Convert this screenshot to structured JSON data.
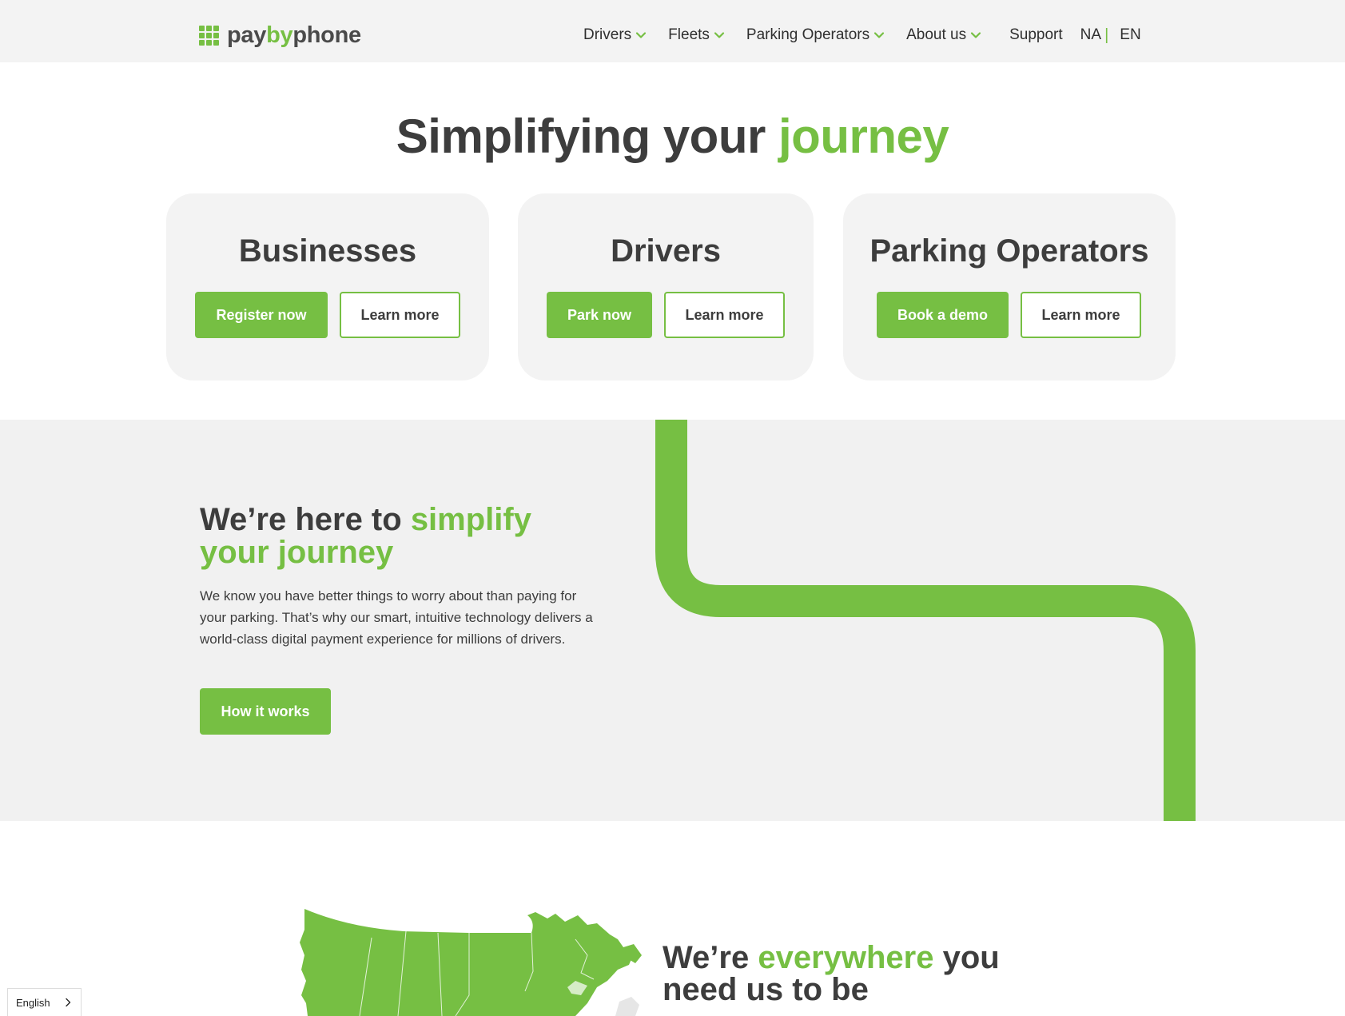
{
  "brand": {
    "logo_pay": "pay",
    "logo_by": "by",
    "logo_phone": "phone",
    "accent": "#76bf43",
    "text_dark": "#3d3d3d"
  },
  "nav": {
    "items": [
      {
        "label": "Drivers",
        "icon": "chevron-down-icon"
      },
      {
        "label": "Fleets",
        "icon": "chevron-down-icon"
      },
      {
        "label": "Parking Operators",
        "icon": "chevron-down-icon"
      },
      {
        "label": "About us",
        "icon": "chevron-down-icon"
      }
    ],
    "support": "Support",
    "region": "NA",
    "separator": "|",
    "language": "EN"
  },
  "hero": {
    "title_main": "Simplifying your",
    "title_highlight": "journey"
  },
  "cards": [
    {
      "title": "Businesses",
      "primary": "Register now",
      "secondary": "Learn more"
    },
    {
      "title": "Drivers",
      "primary": "Park now",
      "secondary": "Learn more"
    },
    {
      "title": "Parking Operators",
      "primary": "Book a demo",
      "secondary": "Learn more"
    }
  ],
  "simplify": {
    "title_main": "We’re here to",
    "title_highlight": "simplify your journey",
    "body": "We know you have better things to worry about than paying for your parking. That’s why our smart, intuitive technology delivers a world-class digital payment experience for millions of drivers.",
    "button": "How it works"
  },
  "everywhere": {
    "title_pre": "We’re",
    "title_highlight": "everywhere",
    "title_post": "you need us to be"
  },
  "language_widget": {
    "label": "English",
    "icon": "chevron-right-icon"
  }
}
